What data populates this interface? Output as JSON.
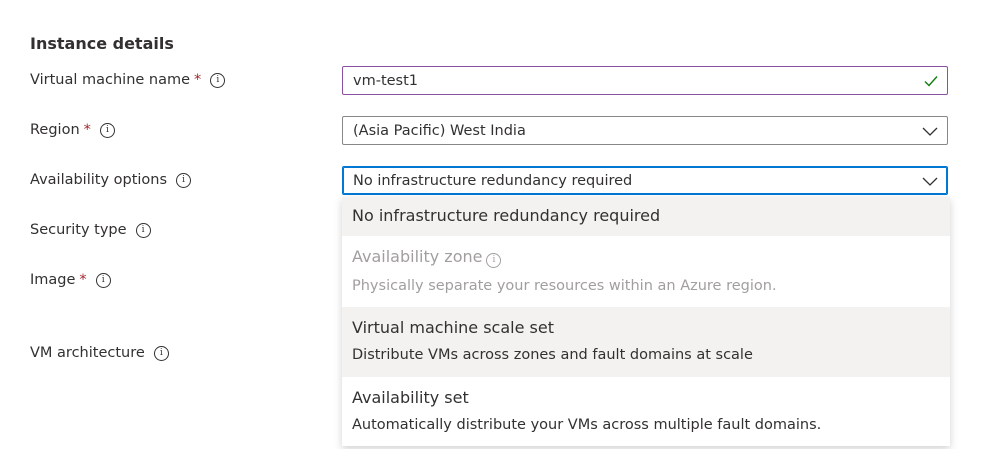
{
  "section": {
    "title": "Instance details"
  },
  "fields": {
    "vm_name": {
      "label": "Virtual machine name",
      "required": "*",
      "value": "vm-test1"
    },
    "region": {
      "label": "Region",
      "required": "*",
      "value": "(Asia Pacific) West India"
    },
    "availability": {
      "label": "Availability options",
      "value": "No infrastructure redundancy required"
    },
    "security": {
      "label": "Security type"
    },
    "image": {
      "label": "Image",
      "required": "*"
    },
    "architecture": {
      "label": "VM architecture"
    }
  },
  "info_glyph": "i",
  "dropdown": {
    "options": [
      {
        "title": "No infrastructure redundancy required"
      },
      {
        "title": "Availability zone",
        "desc": "Physically separate your resources within an Azure region."
      },
      {
        "title": "Virtual machine scale set",
        "desc": "Distribute VMs across zones and fault domains at scale"
      },
      {
        "title": "Availability set",
        "desc": "Automatically distribute your VMs across multiple fault domains."
      }
    ]
  },
  "colors": {
    "required": "#a4262c",
    "focus_border": "#0078d4",
    "valid_check": "#107c10",
    "hover_bg": "#f3f2f1",
    "disabled_text": "#a19f9d"
  }
}
